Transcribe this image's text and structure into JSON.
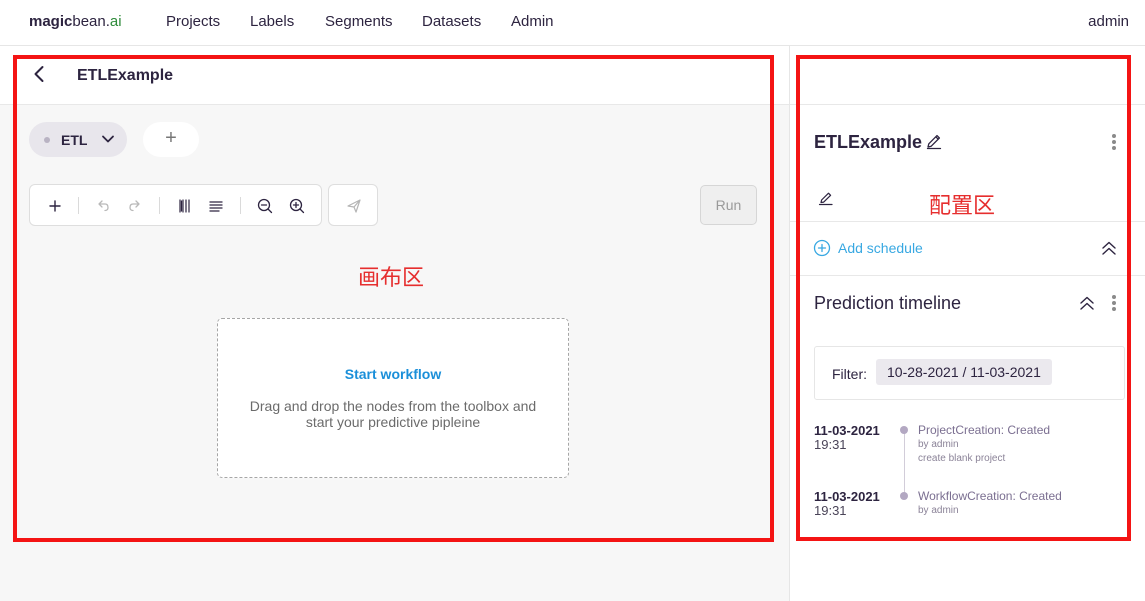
{
  "nav": {
    "brand_bold": "magic",
    "brand_mid": "bean.",
    "brand_ai": "ai",
    "links": [
      "Projects",
      "Labels",
      "Segments",
      "Datasets",
      "Admin"
    ],
    "user": "admin"
  },
  "canvas": {
    "workflow_title": "ETLExample",
    "tab_label": "ETL",
    "add_tab_symbol": "+",
    "run_label": "Run",
    "annotation": "画布区",
    "start_title": "Start workflow",
    "start_text": "Drag and drop the nodes from the toolbox and start your predictive pipleine"
  },
  "config": {
    "title": "ETLExample",
    "annotation": "配置区",
    "add_schedule": "Add schedule",
    "timeline_title": "Prediction timeline",
    "filter_label": "Filter:",
    "filter_value": "10-28-2021 / 11-03-2021",
    "events": [
      {
        "date": "11-03-2021",
        "time": "19:31",
        "event": "ProjectCreation: Created",
        "by": "by admin",
        "note": "create blank project"
      },
      {
        "date": "11-03-2021",
        "time": "19:31",
        "event": "WorkflowCreation: Created",
        "by": "by admin",
        "note": ""
      }
    ]
  },
  "colors": {
    "accent_blue": "#1a8fd9",
    "link_blue": "#38a8e2",
    "annotation_red": "#f41414",
    "brand_green": "#2e8b3a"
  }
}
